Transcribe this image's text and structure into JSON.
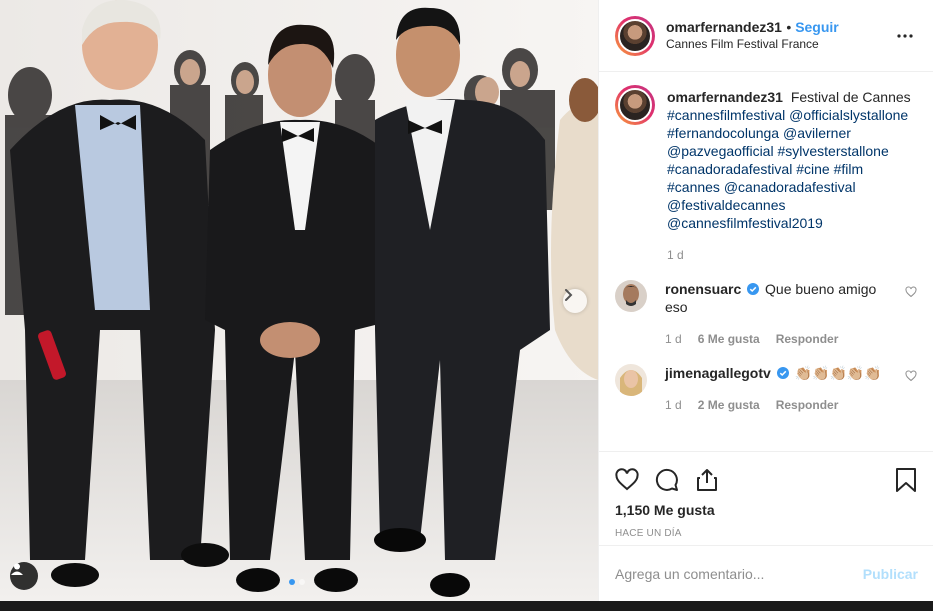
{
  "post": {
    "username": "omarfernandez31",
    "follow_label": "Seguir",
    "location": "Cannes Film Festival France",
    "caption_text": "Festival de Cannes",
    "hashtags": [
      "#cannesfilmfestival",
      "@officialslystallone",
      "#fernandocolunga",
      "@avilerner",
      "@pazvegaofficial",
      "#sylvesterstallone",
      "#canadoradafestival",
      "#cine",
      "#film",
      "#cannes",
      "@canadoradafestival",
      "@festivaldecannes",
      "@cannesfilmfestival2019"
    ],
    "caption_time": "1 d"
  },
  "comments": [
    {
      "username": "ronensuarc",
      "verified": true,
      "text": "Que bueno amigo eso",
      "time": "1 d",
      "likes": "6 Me gusta",
      "reply": "Responder"
    },
    {
      "username": "jimenagallegotv",
      "verified": true,
      "text": "👏🏼👏🏼👏🏼👏🏼👏🏼",
      "time": "1 d",
      "likes": "2 Me gusta",
      "reply": "Responder"
    }
  ],
  "stats": {
    "likes": "1,150 Me gusta",
    "ago": "Hace un día"
  },
  "composer": {
    "placeholder": "Agrega un comentario...",
    "publish": "Publicar"
  },
  "carousel": {
    "slides": 2,
    "active": 1
  },
  "icons": [
    "heart-icon",
    "comment-icon",
    "share-icon",
    "bookmark-icon",
    "more-icon",
    "chevron-right-icon",
    "user-tag-icon",
    "verified-icon"
  ],
  "colors": {
    "accent": "#3897f0",
    "hashtag": "#003569",
    "muted": "#8e8e8e",
    "publish_disabled": "#b2dffc"
  }
}
